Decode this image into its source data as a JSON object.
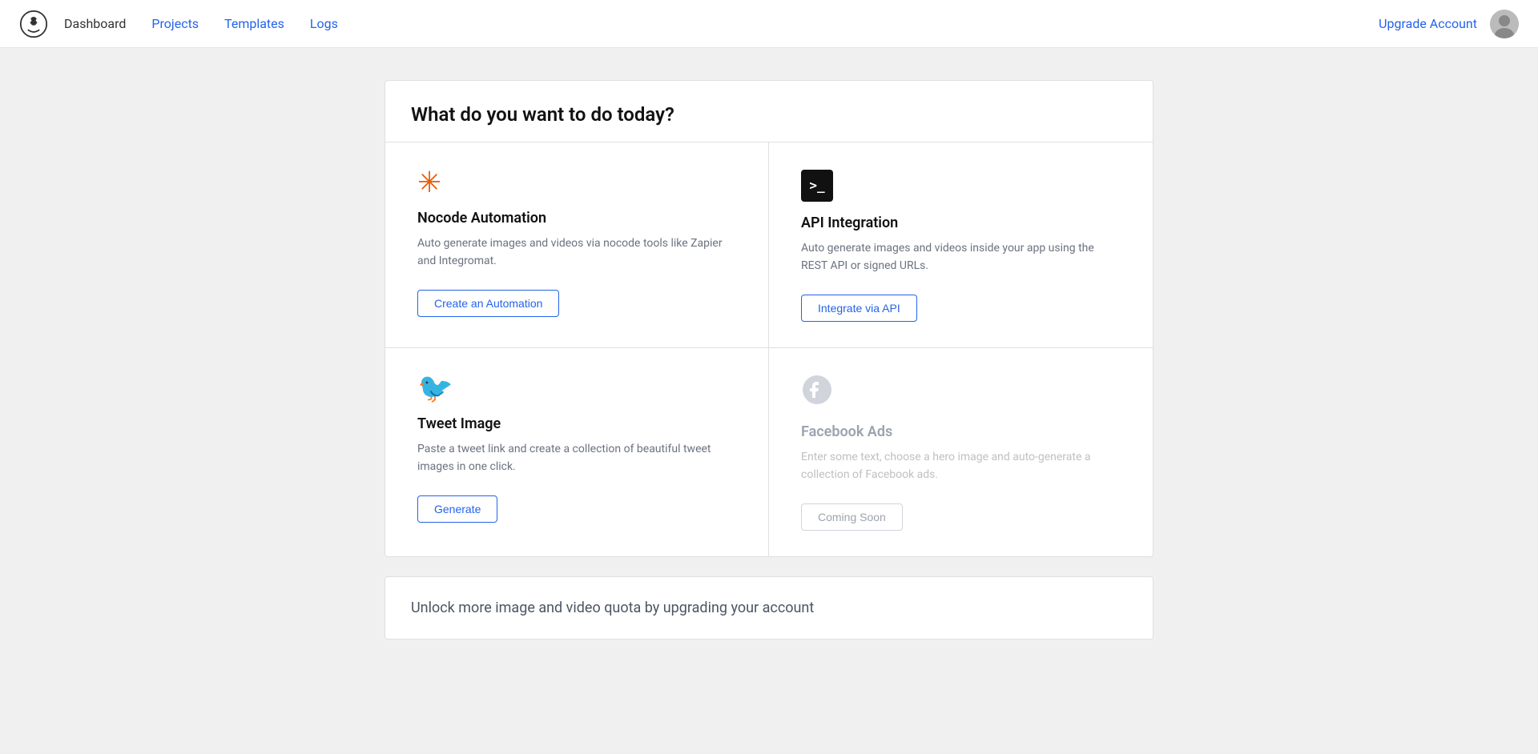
{
  "nav": {
    "logo_alt": "Bannerbear logo",
    "links": [
      {
        "label": "Dashboard",
        "active": false,
        "colored": false
      },
      {
        "label": "Projects",
        "active": false,
        "colored": true
      },
      {
        "label": "Templates",
        "active": false,
        "colored": true
      },
      {
        "label": "Logs",
        "active": false,
        "colored": true
      }
    ],
    "upgrade_label": "Upgrade Account",
    "avatar_alt": "User avatar"
  },
  "main_card": {
    "title": "What do you want to do today?",
    "cells": [
      {
        "id": "nocode",
        "icon_name": "nocode-asterisk-icon",
        "title": "Nocode Automation",
        "description": "Auto generate images and videos via nocode tools like Zapier and Integromat.",
        "button_label": "Create an Automation",
        "button_type": "outline",
        "muted": false
      },
      {
        "id": "api",
        "icon_name": "terminal-icon",
        "title": "API Integration",
        "description": "Auto generate images and videos inside your app using the REST API or signed URLs.",
        "button_label": "Integrate via API",
        "button_type": "outline",
        "muted": false
      },
      {
        "id": "tweet",
        "icon_name": "twitter-icon",
        "title": "Tweet Image",
        "description": "Paste a tweet link and create a collection of beautiful tweet images in one click.",
        "button_label": "Generate",
        "button_type": "outline",
        "muted": false
      },
      {
        "id": "facebook",
        "icon_name": "facebook-icon",
        "title": "Facebook Ads",
        "description": "Enter some text, choose a hero image and auto-generate a collection of Facebook ads.",
        "button_label": "Coming Soon",
        "button_type": "disabled",
        "muted": true
      }
    ]
  },
  "bottom_card": {
    "text": "Unlock more image and video quota by upgrading your account"
  }
}
